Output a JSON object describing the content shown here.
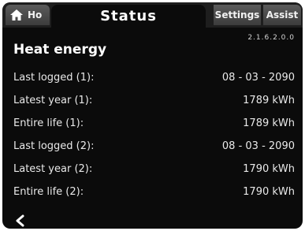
{
  "tabs": {
    "home_label": "Ho",
    "status_label": "Status",
    "settings_label": "Settings",
    "assist_label": "Assist"
  },
  "section_id": "2.1.6.2.0.0",
  "title": "Heat energy",
  "rows": [
    {
      "label": "Last logged (1):",
      "value": "08 - 03 - 2090"
    },
    {
      "label": "Latest year (1):",
      "value": "1789 kWh"
    },
    {
      "label": "Entire life (1):",
      "value": "1789 kWh"
    },
    {
      "label": "Last logged (2):",
      "value": "08 - 03 - 2090"
    },
    {
      "label": "Latest year (2):",
      "value": "1790 kWh"
    },
    {
      "label": "Entire life (2):",
      "value": "1790 kWh"
    }
  ],
  "icons": {
    "home": "home-icon",
    "back": "chevron-left-icon"
  },
  "colors": {
    "screen_background": "#0b0b0b",
    "tab_background": "#4a4a4a",
    "text": "#e9e9e9"
  }
}
